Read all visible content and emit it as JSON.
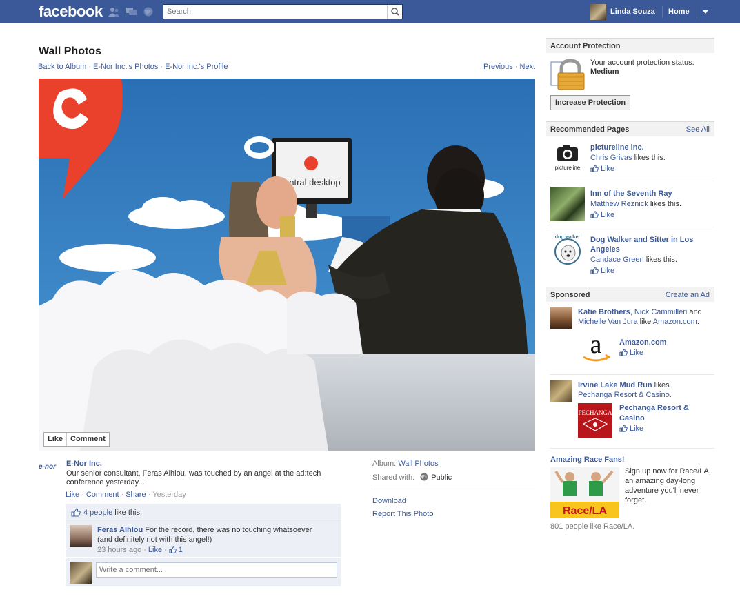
{
  "topbar": {
    "logo": "facebook",
    "search_placeholder": "Search",
    "user_name": "Linda Souza",
    "home": "Home"
  },
  "main": {
    "title": "Wall Photos",
    "links": {
      "back": "Back to Album",
      "photos": "E-Nor Inc.'s Photos",
      "profile": "E-Nor Inc.'s Profile",
      "previous": "Previous",
      "next": "Next"
    },
    "photo_actions": {
      "like": "Like",
      "comment": "Comment"
    },
    "photo_logo_text": "entral desktop",
    "owner_logo": "e-nor",
    "owner": "E-Nor Inc.",
    "caption": "Our senior consultant, Feras Alhlou, was touched by an angel at the ad:tech conference yesterday...",
    "story_actions": {
      "like": "Like",
      "comment": "Comment",
      "share": "Share",
      "time": "Yesterday"
    },
    "likes": {
      "people": "4 people",
      "suffix": " like this."
    },
    "comment": {
      "author": "Feras Alhlou",
      "text": " For the record, there was no touching whatsoever (and definitely not with this angel!)",
      "time": "23 hours ago",
      "like": "Like",
      "like_count": "1"
    },
    "write_placeholder": "Write a comment...",
    "meta": {
      "album_label": "Album:",
      "album_value": "Wall Photos",
      "shared_label": "Shared with:",
      "shared_value": "Public",
      "download": "Download",
      "report": "Report This Photo"
    }
  },
  "sidebar": {
    "protection": {
      "title": "Account Protection",
      "status_text": "Your account protection status:",
      "status_value": "Medium",
      "button": "Increase Protection"
    },
    "recommended": {
      "title": "Recommended Pages",
      "see_all": "See All",
      "items": [
        {
          "name": "pictureline inc.",
          "liker": "Chris Grivas",
          "suffix": " likes this.",
          "like": "Like",
          "logo_text": "pictureline"
        },
        {
          "name": "Inn of the Seventh Ray",
          "liker": "Matthew Reznick",
          "suffix": " likes this.",
          "like": "Like"
        },
        {
          "name": "Dog Walker and Sitter in Los Angeles",
          "liker": "Candace Green",
          "suffix": " likes this.",
          "like": "Like",
          "logo_text": "dog walker"
        }
      ]
    },
    "sponsored": {
      "title": "Sponsored",
      "create_ad": "Create an Ad",
      "ad1": {
        "person1": "Katie Brothers",
        "person2": "Nick Cammilleri",
        "and": " and",
        "person3": "Michelle Van Jura",
        "like_word": " like ",
        "page": "Amazon.com",
        "brand": "Amazon.com",
        "like": "Like"
      },
      "ad2": {
        "person": "Irvine Lake Mud Run",
        "likes_word": " likes",
        "page": "Pechanga Resort & Casino",
        "brand": "Pechanga Resort & Casino",
        "like": "Like",
        "logo_text": "PECHANGA"
      },
      "ad3": {
        "title": "Amazing Race Fans!",
        "text": "Sign up now for Race/LA, an amazing day-long adventure you'll never forget.",
        "footer": "801 people like Race/LA.",
        "logo_text": "Race/LA"
      }
    }
  },
  "colors": {
    "brand": "#3b5998",
    "link": "#3b5998",
    "header_bg": "#f2f2f2"
  }
}
